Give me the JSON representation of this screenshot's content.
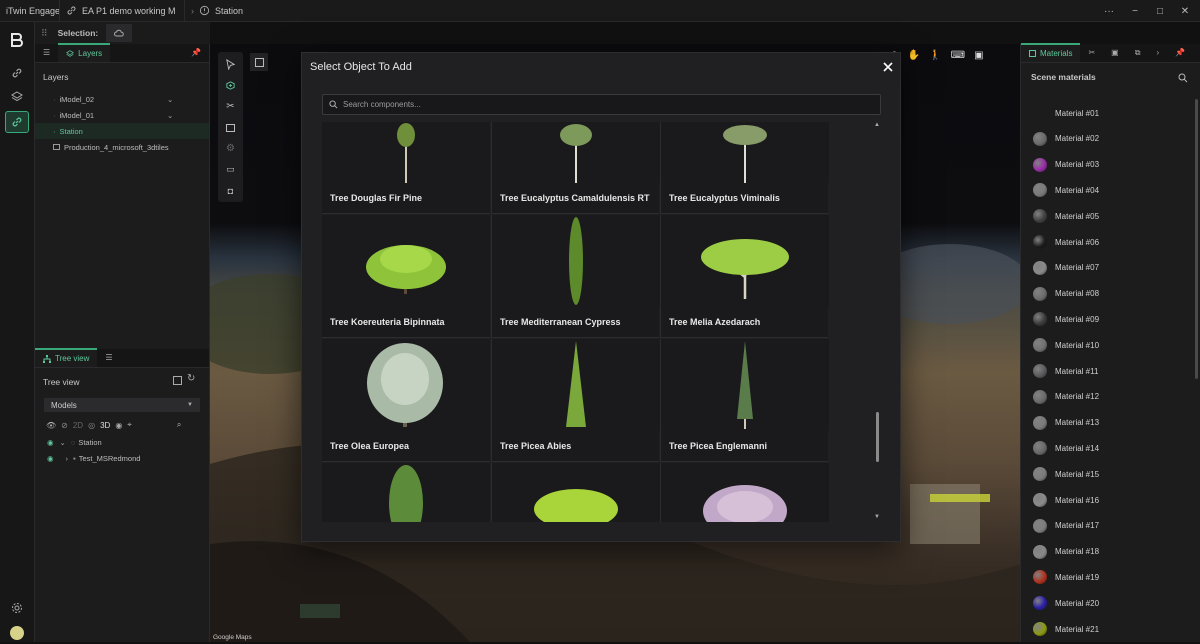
{
  "titlebar": {
    "app_name": "iTwin Engage",
    "project": "EA P1 demo working M",
    "station": "Station",
    "controls": {
      "more": "···",
      "minimize": "−",
      "maximize": "□",
      "close": "✕"
    }
  },
  "selection": {
    "label": "Selection:"
  },
  "layers": {
    "tab_label": "Layers",
    "heading": "Layers",
    "items": [
      {
        "label": "iModel_02"
      },
      {
        "label": "iModel_01"
      },
      {
        "label": "Station"
      },
      {
        "label": "Production_4_microsoft_3dtiles"
      }
    ]
  },
  "tree": {
    "tab_label": "Tree view",
    "heading": "Tree view",
    "dropdown_value": "Models",
    "mode_2d": "2D",
    "mode_3d": "3D",
    "nodes": [
      {
        "label": "Station"
      },
      {
        "label": "Test_MSRedmond"
      }
    ]
  },
  "viewport": {
    "attribution": "Google Maps"
  },
  "modal": {
    "title": "Select Object To Add",
    "search_placeholder": "Search components...",
    "items": [
      {
        "label": "Tree Douglas Fir Pine"
      },
      {
        "label": "Tree Eucalyptus Camaldulensis RT"
      },
      {
        "label": "Tree Eucalyptus Viminalis"
      },
      {
        "label": "Tree Koereuteria Bipinnata"
      },
      {
        "label": "Tree Mediterranean Cypress"
      },
      {
        "label": "Tree Melia Azedarach"
      },
      {
        "label": "Tree Olea Europea"
      },
      {
        "label": "Tree Picea Abies"
      },
      {
        "label": "Tree Picea Englemanni"
      },
      {
        "label": ""
      },
      {
        "label": ""
      },
      {
        "label": ""
      }
    ]
  },
  "materials": {
    "tab_label": "Materials",
    "heading": "Scene materials",
    "items": [
      {
        "label": "Material #01",
        "color": ""
      },
      {
        "label": "Material #02",
        "color": "#6a6a6a"
      },
      {
        "label": "Material #03",
        "color": "#9a2aa8"
      },
      {
        "label": "Material #04",
        "color": "#7a7a7a"
      },
      {
        "label": "Material #05",
        "color": "#3e3e40"
      },
      {
        "label": "Material #06",
        "color": "#1a1a1c"
      },
      {
        "label": "Material #07",
        "color": "#8a8a8a"
      },
      {
        "label": "Material #08",
        "color": "#6c6c6c"
      },
      {
        "label": "Material #09",
        "color": "#3a3a3c"
      },
      {
        "label": "Material #10",
        "color": "#707070"
      },
      {
        "label": "Material #11",
        "color": "#5a5a5c"
      },
      {
        "label": "Material #12",
        "color": "#6a6a6a"
      },
      {
        "label": "Material #13",
        "color": "#7a7a7a"
      },
      {
        "label": "Material #14",
        "color": "#686868"
      },
      {
        "label": "Material #15",
        "color": "#7c7c7c"
      },
      {
        "label": "Material #16",
        "color": "#8a8a8a"
      },
      {
        "label": "Material #17",
        "color": "#7e7e7e"
      },
      {
        "label": "Material #18",
        "color": "#888888"
      },
      {
        "label": "Material #19",
        "color": "#b0301c"
      },
      {
        "label": "Material #20",
        "color": "#2a1ea8"
      },
      {
        "label": "Material #21",
        "color": "#8a9a12"
      }
    ]
  },
  "colors": {
    "accent": "#39a97c"
  }
}
